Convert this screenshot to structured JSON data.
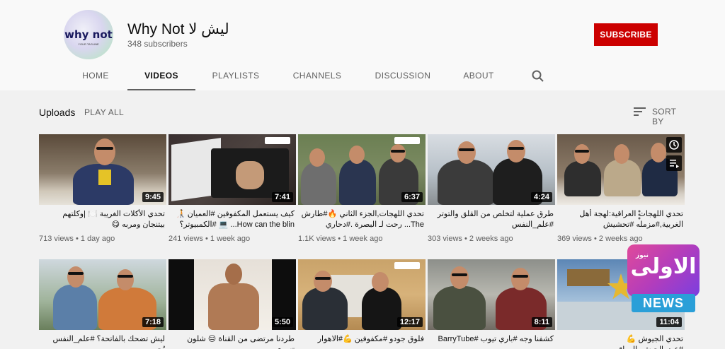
{
  "channel": {
    "name": "ليش لا Why Not",
    "subscribers": "348 subscribers",
    "avatar_text": "why not",
    "avatar_subtext": "YOUR TAGLINE",
    "subscribe_label": "SUBSCRIBE"
  },
  "tabs": [
    "HOME",
    "VIDEOS",
    "PLAYLISTS",
    "CHANNELS",
    "DISCUSSION",
    "ABOUT"
  ],
  "active_tab": "VIDEOS",
  "uploads": {
    "title": "Uploads",
    "play_all": "PLAY ALL",
    "sort_by": "SORT BY"
  },
  "videos": [
    {
      "title": "تحدي الأكلات الغريبة 🍽️ |وكلتهم بيتنجان ومربه 😋",
      "views": "713 views",
      "age": "1 day ago",
      "duration": "9:45"
    },
    {
      "title": "كيف يستعمل المكفوفين #العميان 🧑‍🦯 How can the blin... 💻 ‏#الكمبيوتر؟",
      "views": "241 views",
      "age": "1 week ago",
      "duration": "7:41"
    },
    {
      "title": "تحدي اللهجات,الجزء الثاني 🔥#طارش The... رحت لـ البصرة .#دحاري",
      "views": "1.1K views",
      "age": "1 week ago",
      "duration": "6:37"
    },
    {
      "title": "طرق عملية لتخلص من القلق والتوتر #علم_النفس",
      "views": "303 views",
      "age": "2 weeks ago",
      "duration": "4:24"
    },
    {
      "title": "تحدي اللهجات العراقية:لهجة أهل الغربية,#مزمله #تحشيش",
      "views": "369 views",
      "age": "2 weeks ago",
      "duration": ""
    },
    {
      "title": "ليش تضحك بالفاتحة؟ #علم_النفس يُجيب",
      "views": "",
      "age": "",
      "duration": "7:18"
    },
    {
      "title": "طردنا مرتضى من القناة 😑 شلون تسوي",
      "views": "",
      "age": "",
      "duration": "5:50"
    },
    {
      "title": "فلوق جودو #مكفوفين 💪#الاهوار",
      "views": "",
      "age": "",
      "duration": "12:17"
    },
    {
      "title": "كشفنا وجه #باري تيوب #BarryTube",
      "views": "",
      "age": "",
      "duration": "8:11"
    },
    {
      "title": "تحدي الجيوش 💪 #عيد_الجيش_العراقي",
      "views": "",
      "age": "",
      "duration": "11:04"
    }
  ],
  "watermark": {
    "arabic": "الاولى",
    "small": "نيوز",
    "news": "NEWS"
  },
  "colors": {
    "subscribe": "#cc0000",
    "background": "#f1f1f1",
    "header": "#f9f9f9"
  }
}
